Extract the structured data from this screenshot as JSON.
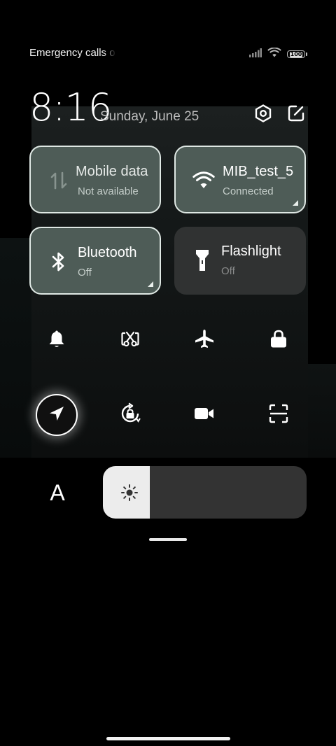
{
  "status_bar": {
    "carrier_text": "Emergency calls o",
    "battery": "100",
    "icons": [
      "signal-icon",
      "wifi-icon",
      "battery-icon"
    ]
  },
  "header": {
    "time": "8:16",
    "date": "Sunday, June 25",
    "settings_icon": "settings-hexagon-icon",
    "edit_icon": "edit-icon"
  },
  "tiles": [
    {
      "title": "Mobile data",
      "subtitle": "Not available",
      "state": "on",
      "icon": "mobile-data-icon"
    },
    {
      "title": "MIB_test_5",
      "subtitle": "Connected",
      "state": "on",
      "icon": "wifi-icon"
    },
    {
      "title": "Bluetooth",
      "subtitle": "Off",
      "state": "on",
      "icon": "bluetooth-icon"
    },
    {
      "title": "Flashlight",
      "subtitle": "Off",
      "state": "off",
      "icon": "flashlight-icon"
    }
  ],
  "toggles": [
    {
      "name": "bell-icon",
      "active": false
    },
    {
      "name": "screenshot-icon",
      "active": false
    },
    {
      "name": "airplane-icon",
      "active": false
    },
    {
      "name": "lock-icon",
      "active": false
    },
    {
      "name": "location-icon",
      "active": true
    },
    {
      "name": "rotation-lock-icon",
      "active": false
    },
    {
      "name": "video-camera-icon",
      "active": false
    },
    {
      "name": "scanner-icon",
      "active": false
    }
  ],
  "brightness": {
    "auto_label": "A",
    "level": 0.23
  },
  "colors": {
    "tile_on": "#4e5c57",
    "tile_off": "#303232",
    "slider_fill": "#ececec",
    "slider_track": "#333333"
  }
}
